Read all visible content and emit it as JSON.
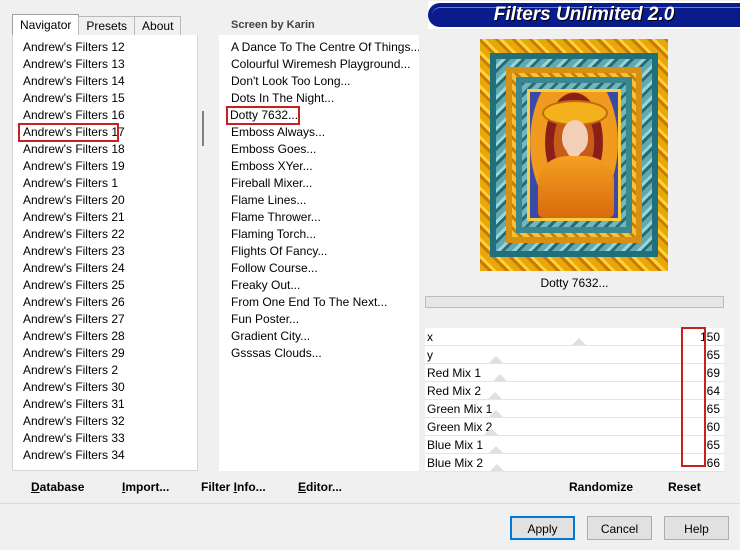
{
  "tabs": [
    {
      "label": "Navigator",
      "active": true
    },
    {
      "label": "Presets",
      "active": false
    },
    {
      "label": "About",
      "active": false
    }
  ],
  "credit": "Screen by Karin",
  "banner": "Filters Unlimited 2.0",
  "categories": [
    "Andrew's Filters 12",
    "Andrew's Filters 13",
    "Andrew's Filters 14",
    "Andrew's Filters 15",
    "Andrew's Filters 16",
    "Andrew's Filters 17",
    "Andrew's Filters 18",
    "Andrew's Filters 19",
    "Andrew's Filters 1",
    "Andrew's Filters 20",
    "Andrew's Filters 21",
    "Andrew's Filters 22",
    "Andrew's Filters 23",
    "Andrew's Filters 24",
    "Andrew's Filters 25",
    "Andrew's Filters 26",
    "Andrew's Filters 27",
    "Andrew's Filters 28",
    "Andrew's Filters 29",
    "Andrew's Filters 2",
    "Andrew's Filters 30",
    "Andrew's Filters 31",
    "Andrew's Filters 32",
    "Andrew's Filters 33",
    "Andrew's Filters 34"
  ],
  "selected_category": "Andrew's Filters 17",
  "filters": [
    "A Dance To The Centre Of Things...",
    "Colourful Wiremesh Playground...",
    "Don't Look Too Long...",
    "Dots In The Night...",
    "Dotty 7632...",
    "Emboss Always...",
    "Emboss Goes...",
    "Emboss XYer...",
    "Fireball Mixer...",
    "Flame Lines...",
    "Flame Thrower...",
    "Flaming Torch...",
    "Flights Of Fancy...",
    "Follow Course...",
    "Freaky Out...",
    "From One End To The Next...",
    "Fun Poster...",
    "Gradient City...",
    "Gsssas Clouds..."
  ],
  "selected_filter": "Dotty 7632...",
  "filter_name": "Dotty 7632...",
  "params": [
    {
      "label": "x",
      "value": "150",
      "level": 150
    },
    {
      "label": "y",
      "value": "65",
      "level": 65
    },
    {
      "label": "Red Mix 1",
      "value": "69",
      "level": 69
    },
    {
      "label": "Red Mix 2",
      "value": "64",
      "level": 64
    },
    {
      "label": "Green Mix 1",
      "value": "65",
      "level": 65
    },
    {
      "label": "Green Mix 2",
      "value": "60",
      "level": 60
    },
    {
      "label": "Blue Mix 1",
      "value": "65",
      "level": 65
    },
    {
      "label": "Blue Mix 2",
      "value": "66",
      "level": 66
    }
  ],
  "param_max": 255,
  "toolbar": {
    "database": {
      "u": "D",
      "rest": "atabase"
    },
    "import": {
      "u": "I",
      "rest": "mport..."
    },
    "filter_info": {
      "pre": "Filter ",
      "u": "I",
      "rest": "nfo..."
    },
    "editor": {
      "u": "E",
      "rest": "ditor..."
    },
    "randomize": "Randomize",
    "reset": "Reset"
  },
  "buttons": {
    "apply": "Apply",
    "cancel": "Cancel",
    "help": "Help"
  }
}
